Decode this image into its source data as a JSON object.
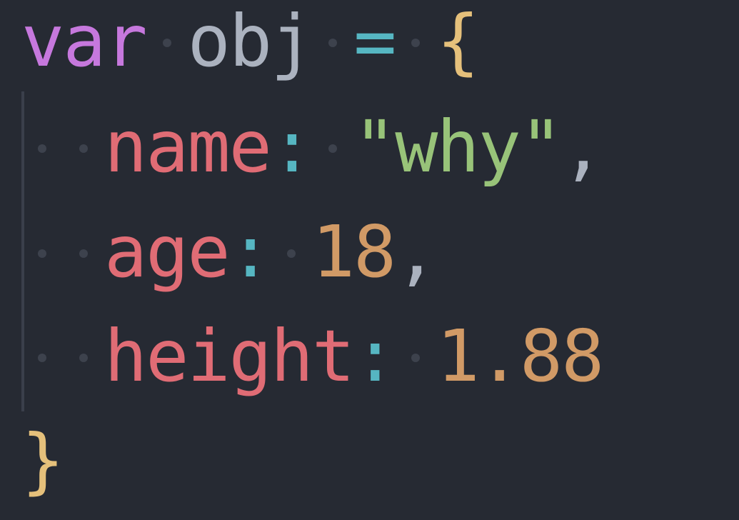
{
  "code": {
    "line1": {
      "keyword": "var",
      "identifier": "obj",
      "operator": "=",
      "open_brace": "{"
    },
    "line2": {
      "property": "name",
      "colon": ":",
      "value": "\"why\"",
      "comma": ","
    },
    "line3": {
      "property": "age",
      "colon": ":",
      "value": "18",
      "comma": ","
    },
    "line4": {
      "property": "height",
      "colon": ":",
      "value": "1.88"
    },
    "line5": {
      "close_brace": "}"
    }
  },
  "colors": {
    "background": "#262a33",
    "keyword": "#c678dd",
    "identifier": "#abb2bf",
    "operator": "#56b6c2",
    "brace": "#e5c07b",
    "property": "#e06c75",
    "string": "#98c379",
    "number": "#d19a66"
  }
}
